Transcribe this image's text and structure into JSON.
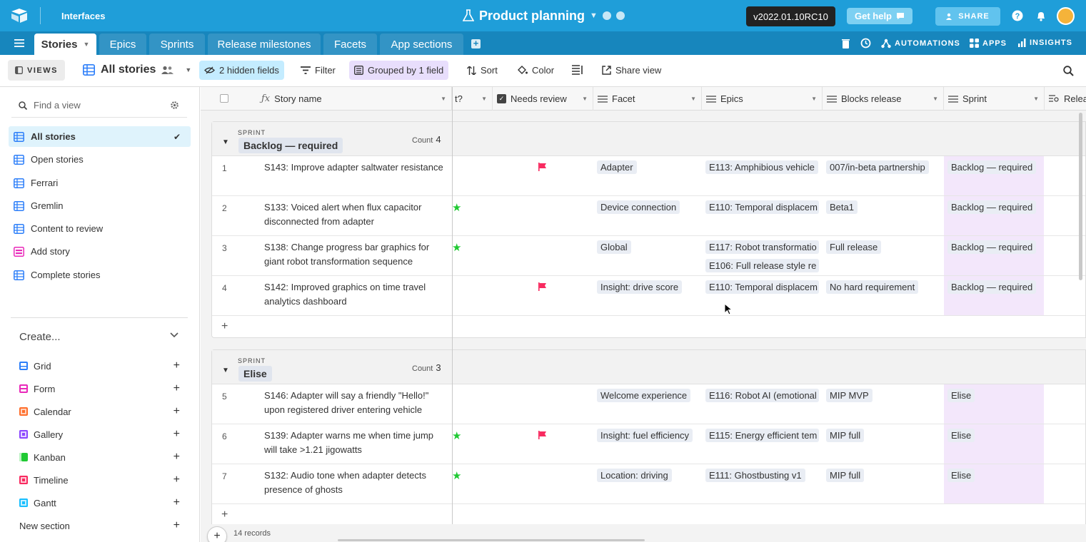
{
  "app": {
    "interfaces_label": "Interfaces",
    "base_title": "Product planning",
    "version": "v2022.01.10RC10",
    "get_help": "Get help",
    "share": "SHARE",
    "colors": {
      "topbar": "#1f9ed9",
      "tabbar": "#1786bd"
    }
  },
  "tabs": [
    {
      "label": "Stories",
      "active": true
    },
    {
      "label": "Epics"
    },
    {
      "label": "Sprints"
    },
    {
      "label": "Release milestones"
    },
    {
      "label": "Facets"
    },
    {
      "label": "App sections"
    }
  ],
  "tabbar_right": {
    "automations": "AUTOMATIONS",
    "apps": "APPS",
    "insights": "INSIGHTS"
  },
  "viewbar": {
    "views": "VIEWS",
    "current_view": "All stories",
    "hidden_fields": "2 hidden fields",
    "filter": "Filter",
    "grouped": "Grouped by 1 field",
    "sort": "Sort",
    "color": "Color",
    "share_view": "Share view"
  },
  "sidebar": {
    "find_placeholder": "Find a view",
    "views": [
      {
        "label": "All stories",
        "active": true
      },
      {
        "label": "Open stories"
      },
      {
        "label": "Ferrari"
      },
      {
        "label": "Gremlin"
      },
      {
        "label": "Content to review"
      },
      {
        "label": "Add story"
      },
      {
        "label": "Complete stories"
      }
    ],
    "create_label": "Create...",
    "create_items": [
      {
        "label": "Grid",
        "color": "#2d7ff9"
      },
      {
        "label": "Form",
        "color": "#e929ba"
      },
      {
        "label": "Calendar",
        "color": "#ff6f2c"
      },
      {
        "label": "Gallery",
        "color": "#8b46ff"
      },
      {
        "label": "Kanban",
        "color": "#20c933"
      },
      {
        "label": "Timeline",
        "color": "#f82b60"
      },
      {
        "label": "Gantt",
        "color": "#18bfff"
      }
    ],
    "new_section": "New section"
  },
  "grid": {
    "columns": [
      "Story name",
      "t?",
      "Needs review",
      "Facet",
      "Epics",
      "Blocks release",
      "Sprint",
      "Relea"
    ],
    "groups": [
      {
        "label": "SPRINT",
        "name": "Backlog — required",
        "count_label": "Count",
        "count": "4",
        "rows": [
          {
            "num": "1",
            "name": "S143: Improve adapter saltwater resistance",
            "star": false,
            "flag": true,
            "facet": "Adapter",
            "epics": [
              "E113: Amphibious vehicle"
            ],
            "blocks": "007/in-beta partnership",
            "sprint": "Backlog — required"
          },
          {
            "num": "2",
            "name": "S133: Voiced alert when flux capacitor disconnected from adapter",
            "star": true,
            "flag": false,
            "facet": "Device connection",
            "epics": [
              "E110: Temporal displacem"
            ],
            "blocks": "Beta1",
            "sprint": "Backlog — required"
          },
          {
            "num": "3",
            "name": "S138: Change progress bar graphics for giant robot transformation sequence",
            "star": true,
            "flag": false,
            "facet": "Global",
            "epics": [
              "E117: Robot transformatio",
              "E106: Full release style re"
            ],
            "blocks": "Full release",
            "sprint": "Backlog — required"
          },
          {
            "num": "4",
            "name": "S142: Improved graphics on time travel analytics dashboard",
            "star": false,
            "flag": true,
            "facet": "Insight: drive score",
            "epics": [
              "E110: Temporal displacem"
            ],
            "blocks": "No hard requirement",
            "sprint": "Backlog — required"
          }
        ]
      },
      {
        "label": "SPRINT",
        "name": "Elise",
        "count_label": "Count",
        "count": "3",
        "rows": [
          {
            "num": "5",
            "name": "S146: Adapter will say a friendly \"Hello!\" upon registered driver entering vehicle",
            "star": false,
            "flag": false,
            "facet": "Welcome experience",
            "epics": [
              "E116: Robot AI (emotional"
            ],
            "blocks": "MIP MVP",
            "sprint": "Elise"
          },
          {
            "num": "6",
            "name": "S139: Adapter warns me when time jump will take >1.21 jigowatts",
            "star": true,
            "flag": true,
            "facet": "Insight: fuel efficiency",
            "epics": [
              "E115: Energy efficient tem"
            ],
            "blocks": "MIP full",
            "sprint": "Elise"
          },
          {
            "num": "7",
            "name": "S132: Audio tone when adapter detects presence of ghosts",
            "star": true,
            "flag": false,
            "facet": "Location: driving",
            "epics": [
              "E111: Ghostbusting v1"
            ],
            "blocks": "MIP full",
            "sprint": "Elise"
          }
        ]
      }
    ],
    "add_row": "+",
    "records": "14 records"
  }
}
